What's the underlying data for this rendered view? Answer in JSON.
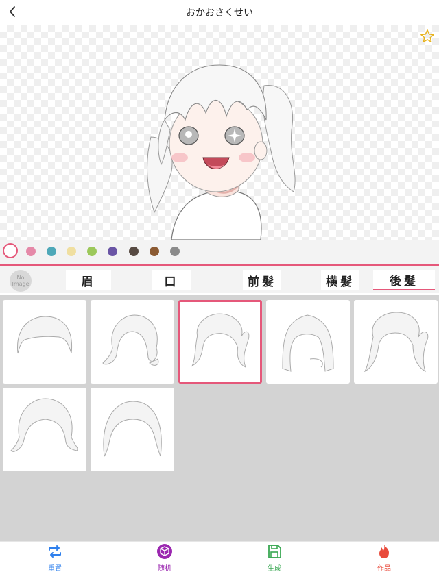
{
  "header": {
    "title": "おかおさくせい",
    "back_icon": "chevron-left-icon",
    "favorite_icon": "star-outline-icon"
  },
  "colors": {
    "accent": "#e5587a",
    "swatches": [
      "#ffffff",
      "#e589a8",
      "#4ea8b8",
      "#f0dfa0",
      "#9cc85a",
      "#6a55a5",
      "#574a42",
      "#8b5a32",
      "#8a8a8a"
    ],
    "selected_swatch_index": 0
  },
  "tabs": {
    "items": [
      {
        "label": "No Image"
      },
      {
        "label": "眉"
      },
      {
        "label": "口"
      },
      {
        "label": "前髪"
      },
      {
        "label": "横髪"
      },
      {
        "label": "後髪"
      }
    ],
    "active_index": 5
  },
  "grid": {
    "item_count": 7,
    "selected_index": 2,
    "items": [
      "short-bob-hair",
      "wavy-short-hair",
      "twin-tail-hair",
      "long-straight-hair",
      "side-tails-hair",
      "spiky-short-hair",
      "bob-hair"
    ]
  },
  "bottom_nav": [
    {
      "label": "重置",
      "icon": "repeat-icon",
      "color": "#2f80ed"
    },
    {
      "label": "随机",
      "icon": "dice-icon",
      "color": "#9b27b0"
    },
    {
      "label": "生成",
      "icon": "save-icon",
      "color": "#3aa853"
    },
    {
      "label": "作品",
      "icon": "fire-icon",
      "color": "#e94b3c"
    }
  ]
}
